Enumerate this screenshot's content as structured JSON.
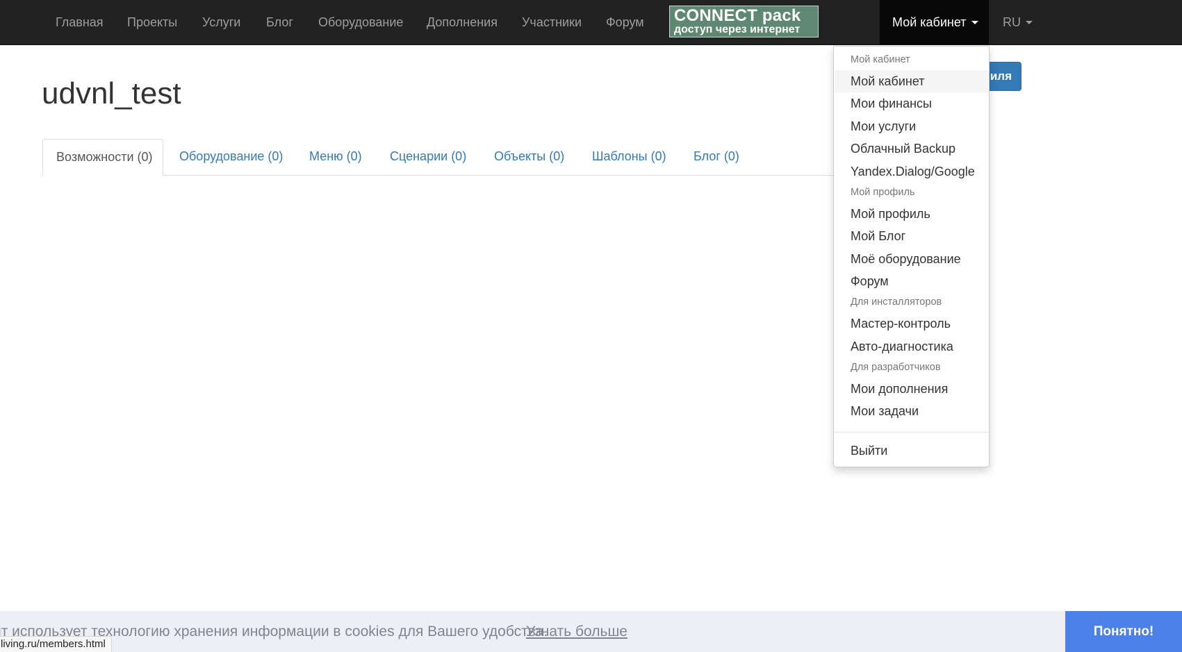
{
  "nav": {
    "items": [
      "Главная",
      "Проекты",
      "Услуги",
      "Блог",
      "Оборудование",
      "Дополнения",
      "Участники",
      "Форум"
    ],
    "logo_line1": "CONNECT pack",
    "logo_line2": "доступ через интернет",
    "cabinet_label": "Мой кабинет",
    "language": "RU"
  },
  "page": {
    "title": "udvnl_test",
    "edit_button_visible": "иля"
  },
  "tabs": [
    "Возможности (0)",
    "Оборудование (0)",
    "Меню (0)",
    "Сценарии (0)",
    "Объекты (0)",
    "Шаблоны (0)",
    "Блог (0)"
  ],
  "dropdown": {
    "headers": [
      "Мой кабинет",
      "Мой профиль",
      "Для инсталляторов",
      "Для разработчиков"
    ],
    "items": [
      "Мой кабинет",
      "Мои финансы",
      "Мои услуги",
      "Облачный Backup",
      "Yandex.Dialog/Google",
      "Мой профиль",
      "Мой Блог",
      "Моё оборудование",
      "Форум",
      "Мастер-контроль",
      "Авто-диагностика",
      "Мои дополнения",
      "Мои задачи"
    ],
    "logout": "Выйти"
  },
  "cookie": {
    "text": "йт использует технологию хранения информации в cookies для Вашего удобства.",
    "link": "Узнать больше",
    "button": "Понятно!"
  },
  "status_url": "living.ru/members.html",
  "colors": {
    "navbar": "#222222",
    "nav_text": "#9d9d9d",
    "primary": "#337ab7",
    "logo_bg": "#5f8873",
    "cookie_button": "#4b81e8"
  }
}
